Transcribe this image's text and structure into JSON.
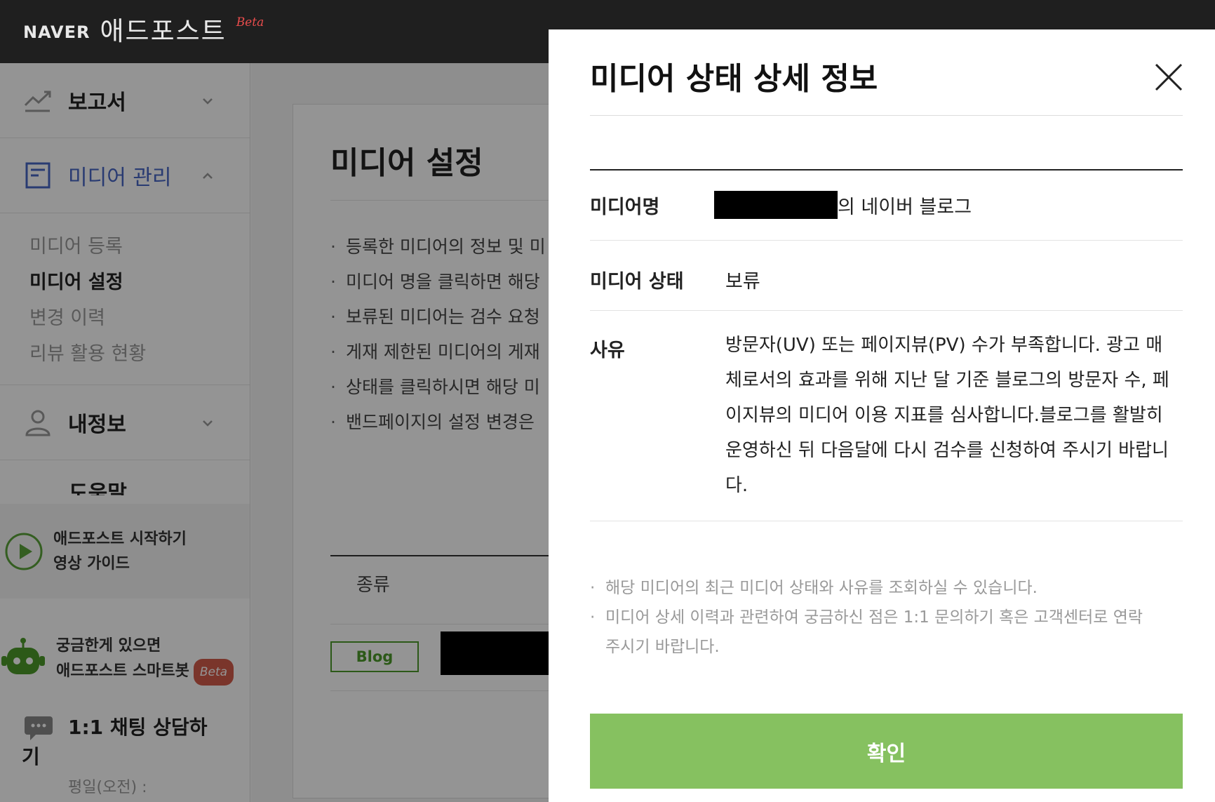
{
  "brand": {
    "naver": "NAVER",
    "product": "애드포스트",
    "beta": "Beta"
  },
  "sidebar": {
    "sections": [
      {
        "label": "보고서"
      },
      {
        "label": "미디어 관리"
      },
      {
        "label": "내정보"
      },
      {
        "label": "도움말"
      }
    ],
    "media_sub": [
      "미디어 등록",
      "미디어 설정",
      "변경 이력",
      "리뷰 활용 현황"
    ],
    "guide": {
      "line1": "애드포스트 시작하기",
      "line2": "영상 가이드"
    },
    "bot": {
      "line1": "궁금한게 있으면",
      "line2": "애드포스트 스마트봇",
      "badge": "Beta"
    },
    "chat": {
      "line1": "1:1 채팅 상담하",
      "line2": "기",
      "hours": "평일(오전) :"
    }
  },
  "main": {
    "title": "미디어 설정",
    "notices": [
      "등록한 미디어의 정보 및 미",
      "미디어 명을 클릭하면 해당",
      "보류된 미디어는 검수 요청",
      "게재 제한된 미디어의 게재",
      "상태를 클릭하시면 해당 미",
      "밴드페이지의 설정 변경은"
    ],
    "table_col": "종류",
    "row_type": "Blog"
  },
  "modal": {
    "title": "미디어 상태 상세 정보",
    "rows": {
      "name_label": "미디어명",
      "name_value": "의 네이버 블로그",
      "status_label": "미디어 상태",
      "status_value": "보류",
      "reason_label": "사유",
      "reason_value": "방문자(UV) 또는 페이지뷰(PV) 수가 부족합니다. 광고 매체로서의 효과를 위해 지난 달 기준 블로그의 방문자 수, 페이지뷰의 미디어 이용 지표를 심사합니다.블로그를 활발히 운영하신 뒤 다음달에 다시 검수를 신청하여 주시기 바랍니다."
    },
    "notes": [
      "해당 미디어의 최근 미디어 상태와 사유를 조회하실 수 있습니다.",
      "미디어 상세 이력과 관련하여 궁금하신 점은 1:1 문의하기 혹은 고객센터로 연락 주시기 바랍니다."
    ],
    "confirm": "확인"
  },
  "colors": {
    "accent_green": "#86c160",
    "blog_green": "#4c9a2a",
    "active_blue": "#4867c4",
    "topbar": "#1f1f1f"
  },
  "icons": [
    "chart-icon",
    "document-icon",
    "user-icon",
    "chevron-down-icon",
    "chevron-up-icon",
    "play-icon",
    "robot-icon",
    "chat-bubble-icon",
    "close-icon"
  ]
}
